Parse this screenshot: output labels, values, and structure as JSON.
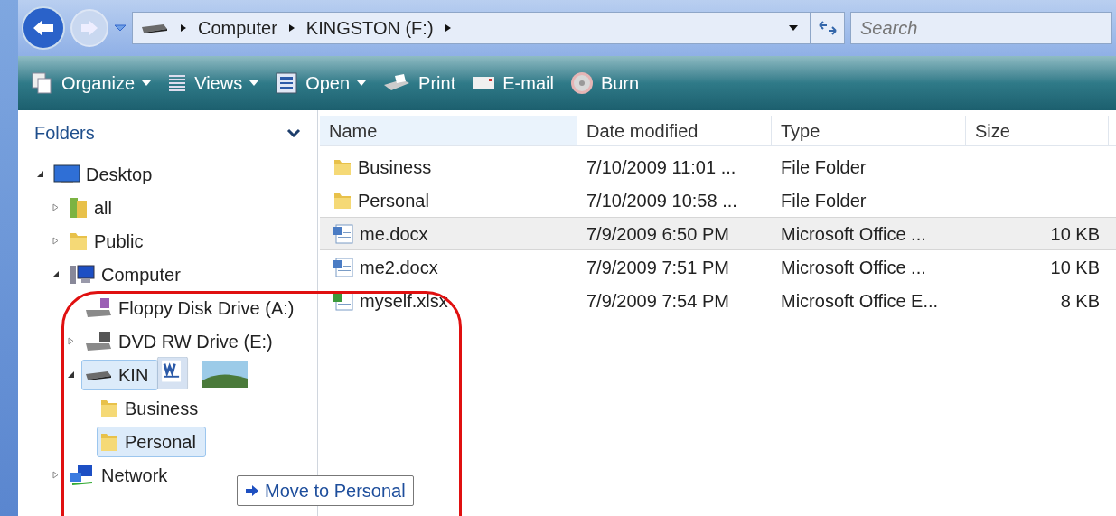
{
  "nav": {
    "breadcrumbs": [
      "Computer",
      "KINGSTON (F:)"
    ],
    "search": {
      "placeholder": "Search"
    }
  },
  "toolbar": [
    {
      "label": "Organize",
      "kind": "organize",
      "dropdown": true
    },
    {
      "label": "Views",
      "kind": "views",
      "dropdown": true
    },
    {
      "label": "Open",
      "kind": "open",
      "dropdown": true
    },
    {
      "label": "Print",
      "kind": "print",
      "dropdown": false
    },
    {
      "label": "E-mail",
      "kind": "email",
      "dropdown": false
    },
    {
      "label": "Burn",
      "kind": "burn",
      "dropdown": false
    }
  ],
  "folders": {
    "title": "Folders",
    "tree": [
      {
        "label": "Desktop",
        "kind": "desktop",
        "expanded": true,
        "selected": false,
        "children": [
          {
            "label": "all",
            "kind": "library",
            "expanded": false,
            "selected": false
          },
          {
            "label": "Public",
            "kind": "folder",
            "expanded": false,
            "selected": false
          },
          {
            "label": "Computer",
            "kind": "computer",
            "expanded": true,
            "selected": false,
            "children": [
              {
                "label": "Floppy Disk Drive (A:)",
                "kind": "floppy",
                "selected": false
              },
              {
                "label": "DVD RW Drive (E:)",
                "kind": "dvd",
                "expanded": false,
                "selected": false
              },
              {
                "label": "KIN",
                "kind": "drive",
                "expanded": true,
                "selected": true,
                "children": [
                  {
                    "label": "Business",
                    "kind": "folder",
                    "selected": false
                  },
                  {
                    "label": "Personal",
                    "kind": "folder",
                    "selected": true
                  }
                ]
              }
            ]
          },
          {
            "label": "Network",
            "kind": "network",
            "expanded": false,
            "selected": false
          }
        ]
      }
    ]
  },
  "table": {
    "columns": [
      "Name",
      "Date modified",
      "Type",
      "Size"
    ],
    "rows": [
      {
        "kind": "folder",
        "name": "Business",
        "date": "7/10/2009 11:01 ...",
        "type": "File Folder",
        "selected": false
      },
      {
        "kind": "folder",
        "name": "Personal",
        "date": "7/10/2009 10:58 ...",
        "type": "File Folder",
        "selected": false
      },
      {
        "kind": "word",
        "name": "me.docx",
        "date": "7/9/2009 6:50 PM",
        "type": "Microsoft Office ...",
        "size": "10 KB",
        "selected": true
      },
      {
        "kind": "word",
        "name": "me2.docx",
        "date": "7/9/2009 7:51 PM",
        "type": "Microsoft Office ...",
        "size": "10 KB",
        "selected": false
      },
      {
        "kind": "excel",
        "name": "myself.xlsx",
        "date": "7/9/2009 7:54 PM",
        "type": "Microsoft Office E...",
        "size": "8 KB",
        "selected": false
      }
    ]
  },
  "drag": {
    "tooltip": "Move to Personal"
  }
}
